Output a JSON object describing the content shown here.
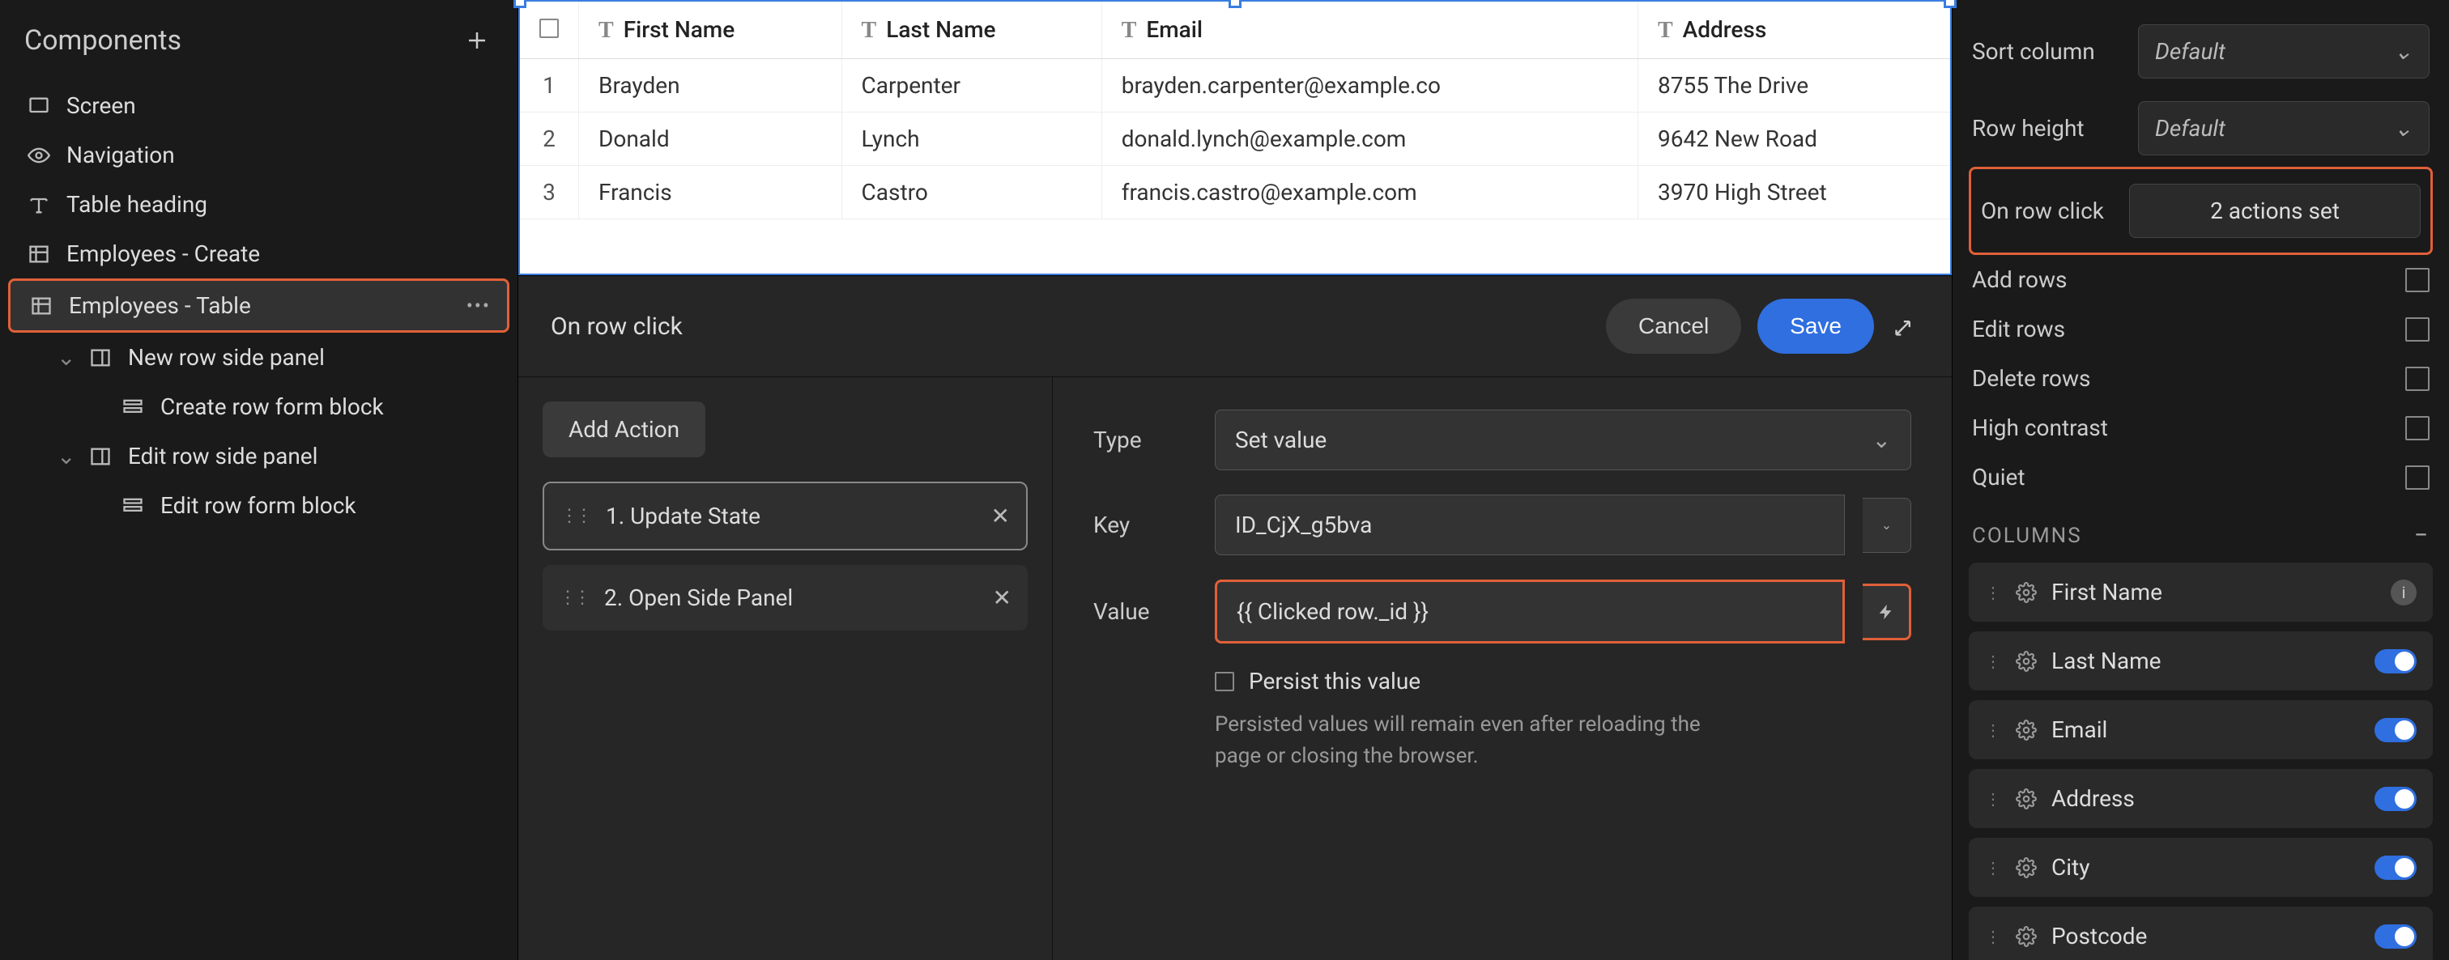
{
  "left": {
    "title": "Components",
    "items": [
      {
        "icon": "screen",
        "label": "Screen",
        "indent": 0
      },
      {
        "icon": "eye",
        "label": "Navigation",
        "indent": 0
      },
      {
        "icon": "text",
        "label": "Table heading",
        "indent": 0
      },
      {
        "icon": "table",
        "label": "Employees - Create",
        "indent": 0
      },
      {
        "icon": "table",
        "label": "Employees - Table",
        "indent": 0,
        "active": true,
        "dots": true
      },
      {
        "icon": "panel",
        "label": "New row side panel",
        "indent": 1,
        "chevron": true
      },
      {
        "icon": "form",
        "label": "Create row form block",
        "indent": 2
      },
      {
        "icon": "panel",
        "label": "Edit row side panel",
        "indent": 1,
        "chevron": true
      },
      {
        "icon": "form",
        "label": "Edit row form block",
        "indent": 2
      }
    ]
  },
  "table": {
    "columns": [
      "First Name",
      "Last Name",
      "Email",
      "Address"
    ],
    "rows": [
      {
        "n": "1",
        "first": "Brayden",
        "last": "Carpenter",
        "email": "brayden.carpenter@example.co",
        "addr": "8755 The Drive"
      },
      {
        "n": "2",
        "first": "Donald",
        "last": "Lynch",
        "email": "donald.lynch@example.com",
        "addr": "9642 New Road"
      },
      {
        "n": "3",
        "first": "Francis",
        "last": "Castro",
        "email": "francis.castro@example.com",
        "addr": "3970 High Street"
      }
    ]
  },
  "modal": {
    "title": "On row click",
    "cancel": "Cancel",
    "save": "Save",
    "add_action": "Add Action",
    "actions": [
      {
        "label": "1. Update State",
        "active": true
      },
      {
        "label": "2. Open Side Panel"
      }
    ],
    "form": {
      "type_label": "Type",
      "type_value": "Set value",
      "key_label": "Key",
      "key_value": "ID_CjX_g5bva",
      "value_label": "Value",
      "value_value": "{{ Clicked row._id }}",
      "persist_label": "Persist this value",
      "persist_help": "Persisted values will remain even after reloading the page or closing the browser."
    }
  },
  "right": {
    "sort_label": "Sort column",
    "sort_value": "Default",
    "rowheight_label": "Row height",
    "rowheight_value": "Default",
    "onrowclick_label": "On row click",
    "onrowclick_value": "2 actions set",
    "toggles": [
      {
        "label": "Add rows"
      },
      {
        "label": "Edit rows"
      },
      {
        "label": "Delete rows"
      },
      {
        "label": "High contrast"
      },
      {
        "label": "Quiet"
      }
    ],
    "columns_header": "COLUMNS",
    "columns": [
      {
        "label": "First Name",
        "info": true
      },
      {
        "label": "Last Name",
        "toggle": true
      },
      {
        "label": "Email",
        "toggle": true
      },
      {
        "label": "Address",
        "toggle": true
      },
      {
        "label": "City",
        "toggle": true
      },
      {
        "label": "Postcode",
        "toggle": true
      }
    ]
  }
}
